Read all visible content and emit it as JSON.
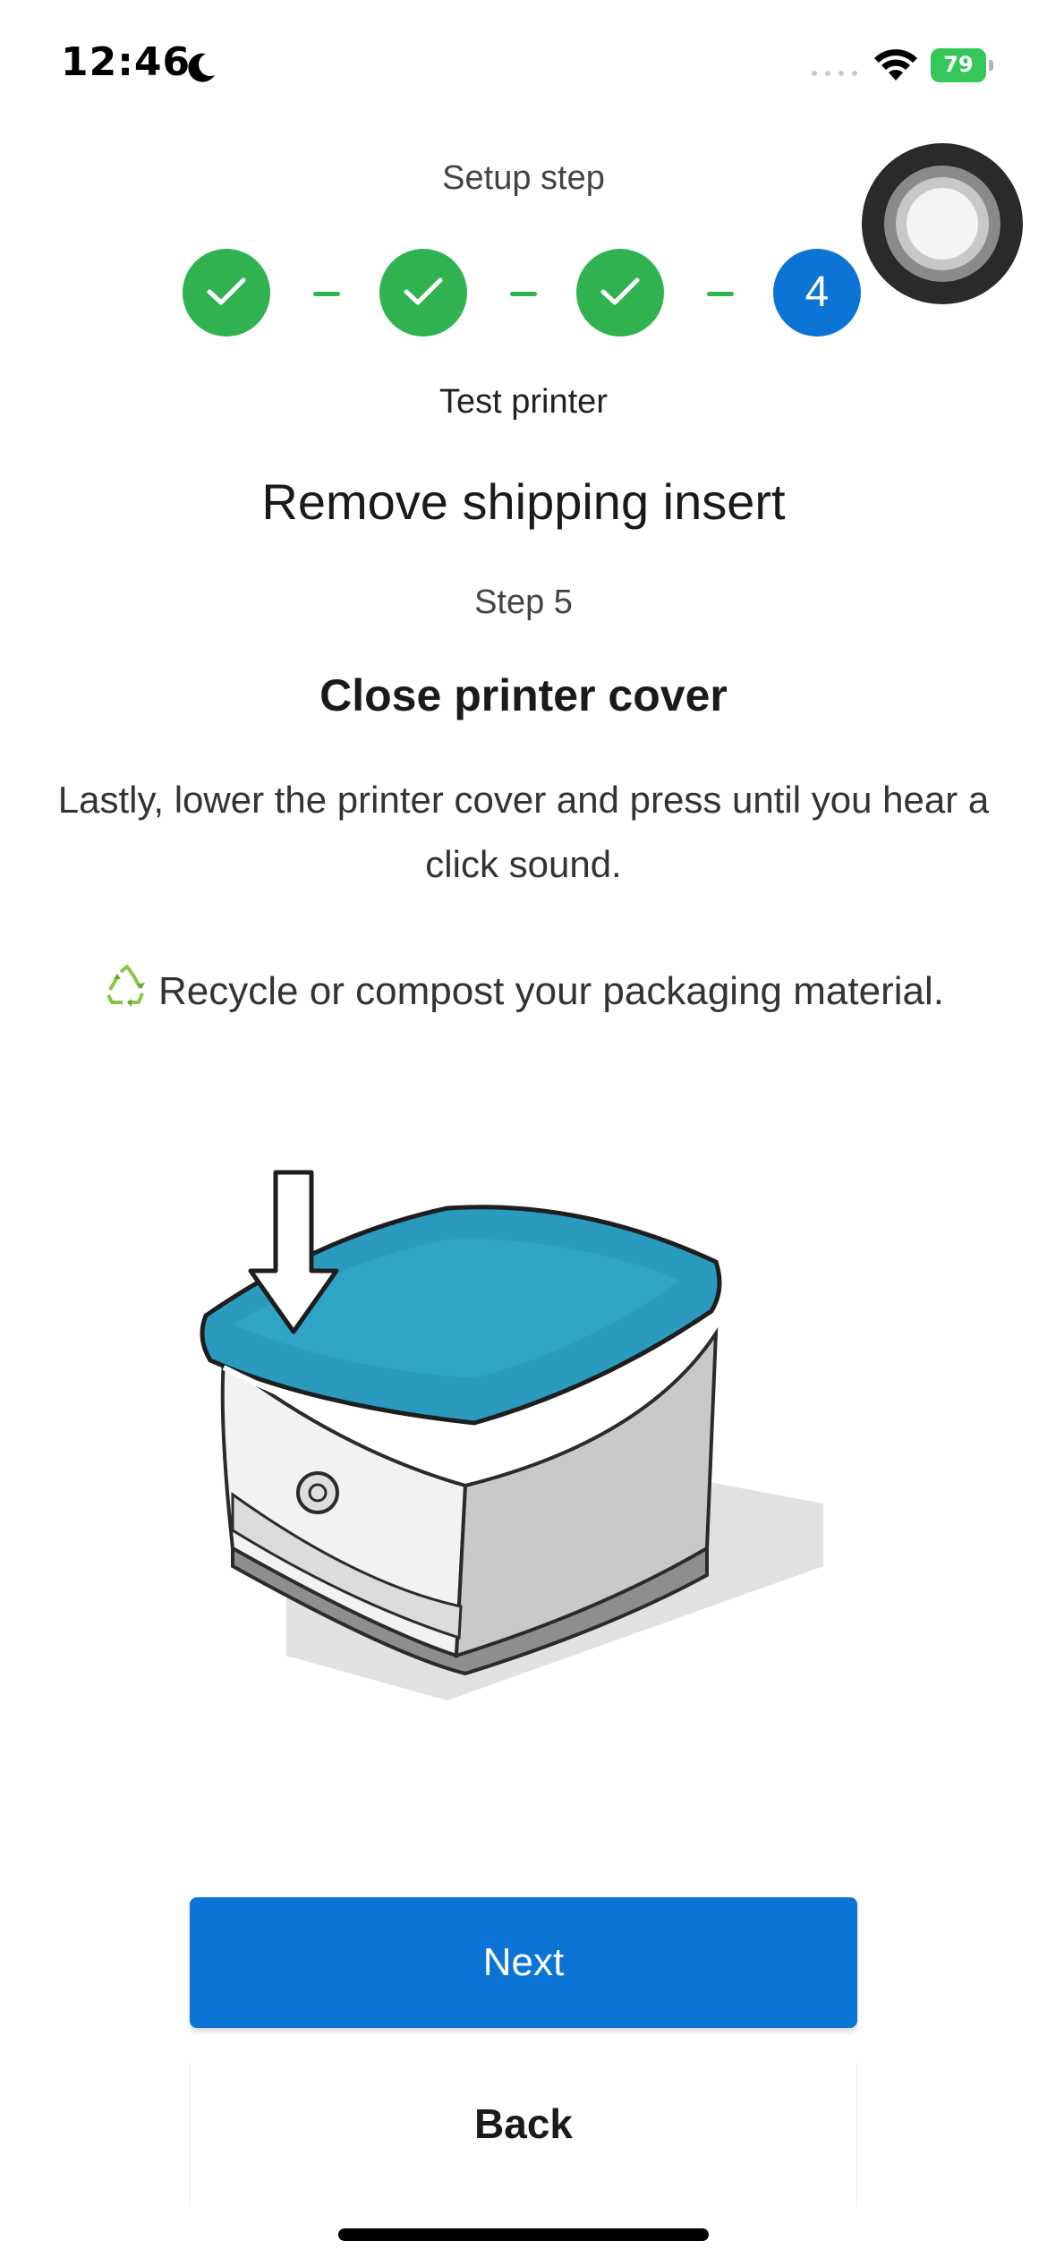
{
  "status_bar": {
    "time": "12:46",
    "battery_percent": "79",
    "icons": [
      "moon-icon",
      "cellular-signal-icon",
      "wifi-icon",
      "battery-icon"
    ]
  },
  "stepper": {
    "label": "Setup step",
    "steps": [
      {
        "state": "done",
        "icon": "checkmark-icon"
      },
      {
        "state": "done",
        "icon": "checkmark-icon"
      },
      {
        "state": "done",
        "icon": "checkmark-icon"
      },
      {
        "state": "current",
        "number": "4"
      }
    ],
    "current_step_name": "Test printer",
    "colors": {
      "done": "#2fb24f",
      "current": "#0b74d4"
    }
  },
  "content": {
    "heading": "Remove shipping insert",
    "step_number": "Step 5",
    "step_title": "Close printer cover",
    "description": "Lastly, lower the printer cover and press until you hear a click sound.",
    "recycle_note": "Recycle or compost your packaging material.",
    "illustration": "printer-cover-closing-illustration"
  },
  "actions": {
    "next_label": "Next",
    "back_label": "Back",
    "primary_color": "#0b74d4"
  }
}
